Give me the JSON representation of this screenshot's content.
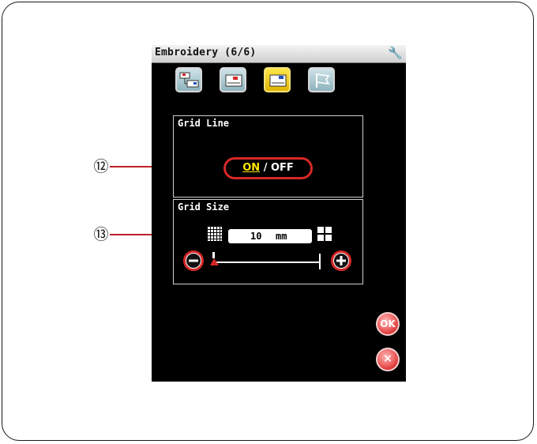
{
  "window": {
    "title": "Embroidery (6/6)"
  },
  "tabs": [
    {
      "name": "tab-1",
      "active": false
    },
    {
      "name": "tab-2",
      "active": false
    },
    {
      "name": "tab-3",
      "active": true
    },
    {
      "name": "tab-4",
      "active": false
    }
  ],
  "grid_line": {
    "label": "Grid Line",
    "on_label": "ON",
    "separator": "/",
    "off_label": "OFF",
    "selected": "ON"
  },
  "grid_size": {
    "label": "Grid Size",
    "value": "10",
    "unit": "mm"
  },
  "buttons": {
    "ok_label": "OK",
    "cancel_label": "×"
  },
  "callouts": {
    "grid_line_num": "⑫",
    "grid_size_num": "⑬"
  },
  "colors": {
    "accent_red": "#d62828",
    "active_tab": "#f2c200",
    "screen_bg": "#000000",
    "on_text": "#ffe600"
  },
  "icons": [
    "wrench-icon",
    "minus-icon",
    "plus-icon",
    "fine-grid-icon",
    "coarse-grid-icon",
    "slider-thumb-icon"
  ]
}
